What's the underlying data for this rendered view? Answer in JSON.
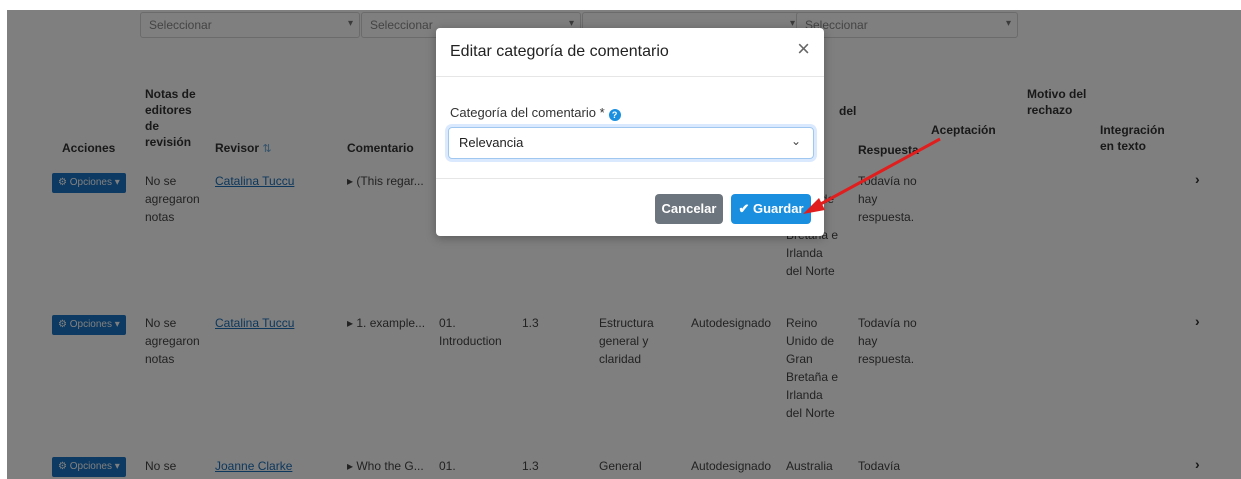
{
  "filters": [
    {
      "label": "Seleccionar"
    },
    {
      "label": "Seleccionar"
    },
    {
      "label": ""
    },
    {
      "label": "Seleccionar"
    }
  ],
  "table": {
    "headers": {
      "acciones": "Acciones",
      "notas": "Notas de editores de revisión",
      "revisor": "Revisor",
      "comentario": "Comentario",
      "del_label": "del",
      "respuesta": "Respuesta",
      "aceptacion": "Aceptación",
      "motivo": "Motivo del rechazo",
      "integracion": "Integración en texto"
    },
    "rows": [
      {
        "button": "Opciones",
        "notes": "No se agregaron notas",
        "reviewer": "Catalina Tuccu",
        "comment": "▸ (This regar...",
        "country": "Reino Unido de Gran Bretaña e Irlanda del Norte",
        "response": "Todavía no hay respuesta."
      },
      {
        "button": "Opciones",
        "notes": "No se agregaron notas",
        "reviewer": "Catalina Tuccu",
        "comment": "▸ 1. example...",
        "section": "01. Introduction",
        "number": "1.3",
        "category": "Estructura general y claridad",
        "type": "Autodesignado",
        "country": "Reino Unido de Gran Bretaña e Irlanda del Norte",
        "response": "Todavía no hay respuesta."
      },
      {
        "button": "Opciones",
        "notes": "No se",
        "reviewer": "Joanne Clarke",
        "comment": "▸ Who the G...",
        "section": "01.",
        "number": "1.3",
        "category": "General",
        "type": "Autodesignado",
        "country": "Australia",
        "response": "Todavía"
      }
    ]
  },
  "modal": {
    "title": "Editar categoría de comentario",
    "close": "×",
    "field_label": "Categoría del comentario *",
    "help_icon": "?",
    "selected": "Relevancia",
    "cancel": "Cancelar",
    "save": "Guardar"
  },
  "colors": {
    "primary": "#1a8fe0",
    "secondary": "#6c757d",
    "arrow": "#e01e1e"
  }
}
